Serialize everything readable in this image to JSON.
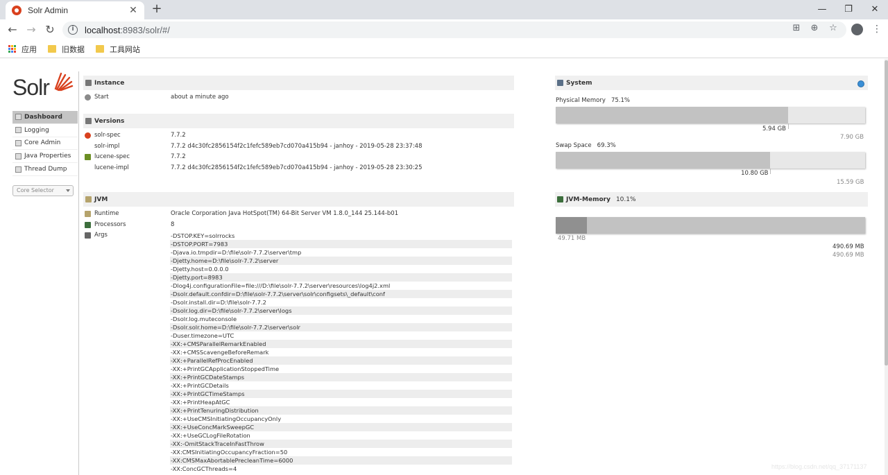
{
  "browser": {
    "tab_title": "Solr Admin",
    "tab_close": "✕",
    "new_tab": "+",
    "url_host": "localhost",
    "url_rest": ":8983/solr/#/",
    "bookmarks": [
      "应用",
      "旧数据",
      "工具网站"
    ]
  },
  "logo": {
    "text": "Solr"
  },
  "nav": {
    "items": [
      "Dashboard",
      "Logging",
      "Core Admin",
      "Java Properties",
      "Thread Dump"
    ],
    "active": "Dashboard",
    "core_selector": "Core Selector"
  },
  "instance": {
    "heading": "Instance",
    "start_label": "Start",
    "start_value": "about a minute ago"
  },
  "versions": {
    "heading": "Versions",
    "rows": [
      {
        "label": "solr-spec",
        "value": "7.7.2"
      },
      {
        "label": "solr-impl",
        "value": "7.7.2 d4c30fc2856154f2c1fefc589eb7cd070a415b94 - janhoy - 2019-05-28 23:37:48"
      },
      {
        "label": "lucene-spec",
        "value": "7.7.2"
      },
      {
        "label": "lucene-impl",
        "value": "7.7.2 d4c30fc2856154f2c1fefc589eb7cd070a415b94 - janhoy - 2019-05-28 23:30:25"
      }
    ]
  },
  "jvm": {
    "heading": "JVM",
    "runtime_label": "Runtime",
    "runtime_value": "Oracle Corporation Java HotSpot(TM) 64-Bit Server VM 1.8.0_144 25.144-b01",
    "processors_label": "Processors",
    "processors_value": "8",
    "args_label": "Args",
    "args": [
      "-DSTOP.KEY=solrrocks",
      "-DSTOP.PORT=7983",
      "-Djava.io.tmpdir=D:\\file\\solr-7.7.2\\server\\tmp",
      "-Djetty.home=D:\\file\\solr-7.7.2\\server",
      "-Djetty.host=0.0.0.0",
      "-Djetty.port=8983",
      "-Dlog4j.configurationFile=file:///D:\\file\\solr-7.7.2\\server\\resources\\log4j2.xml",
      "-Dsolr.default.confdir=D:\\file\\solr-7.7.2\\server\\solr\\configsets\\_default\\conf",
      "-Dsolr.install.dir=D:\\file\\solr-7.7.2",
      "-Dsolr.log.dir=D:\\file\\solr-7.7.2\\server\\logs",
      "-Dsolr.log.muteconsole",
      "-Dsolr.solr.home=D:\\file\\solr-7.7.2\\server\\solr",
      "-Duser.timezone=UTC",
      "-XX:+CMSParallelRemarkEnabled",
      "-XX:+CMSScavengeBeforeRemark",
      "-XX:+ParallelRefProcEnabled",
      "-XX:+PrintGCApplicationStoppedTime",
      "-XX:+PrintGCDateStamps",
      "-XX:+PrintGCDetails",
      "-XX:+PrintGCTimeStamps",
      "-XX:+PrintHeapAtGC",
      "-XX:+PrintTenuringDistribution",
      "-XX:+UseCMSInitiatingOccupancyOnly",
      "-XX:+UseConcMarkSweepGC",
      "-XX:+UseGCLogFileRotation",
      "-XX:-OmitStackTraceInFastThrow",
      "-XX:CMSInitiatingOccupancyFraction=50",
      "-XX:CMSMaxAbortablePrecleanTime=6000",
      "-XX:ConcGCThreads=4"
    ]
  },
  "system": {
    "heading": "System",
    "physical_label": "Physical Memory",
    "physical_pct": "75.1%",
    "physical_fraction": 0.751,
    "physical_used": "5.94 GB",
    "physical_total": "7.90 GB",
    "swap_label": "Swap Space",
    "swap_pct": "69.3%",
    "swap_fraction": 0.693,
    "swap_used": "10.80 GB",
    "swap_total": "15.59 GB"
  },
  "jvm_memory": {
    "heading": "JVM-Memory",
    "pct": "10.1%",
    "used_fraction": 0.101,
    "used": "49.71 MB",
    "committed": "490.69 MB",
    "max": "490.69 MB"
  },
  "watermark": "https://blog.csdn.net/qq_37171137"
}
